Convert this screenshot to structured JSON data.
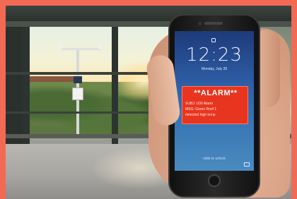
{
  "phone": {
    "time": "12:23",
    "date": "Monday, July 28",
    "alarm": {
      "title": "**ALARM**",
      "line1": "SUBJ: U30 Alarm",
      "line2": "MSG: Green Roof 1",
      "line3": "detected high temp"
    },
    "slide_text": "slide to unlock"
  },
  "colors": {
    "border": "#f26a54",
    "alarm_bg": "#e8351f"
  }
}
